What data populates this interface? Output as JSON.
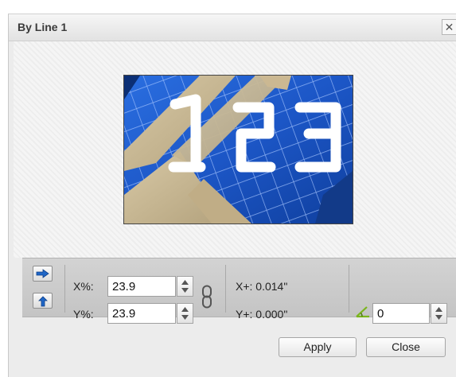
{
  "dialog": {
    "title": "By Line 1",
    "close_glyph": "✕"
  },
  "preview": {
    "image_text": "123"
  },
  "controls": {
    "x_label": "X%:",
    "x_value": "23.9",
    "y_label": "Y%:",
    "y_value": "23.9",
    "x_offset_text": "X+: 0.014\"",
    "y_offset_text": "Y+: 0.000\"",
    "angle_value": "0"
  },
  "buttons": {
    "apply": "Apply",
    "close": "Close"
  },
  "icons": {
    "horizontal": "arrow-right-icon",
    "vertical": "arrow-up-icon",
    "link": "chain-link-icon",
    "angle": "angle-icon",
    "spinner": "up-down-spinner-icon"
  },
  "colors": {
    "arrow": "#1f66c6",
    "angle_icon": "#7ab51d",
    "image_blue": "#1d55c8"
  }
}
